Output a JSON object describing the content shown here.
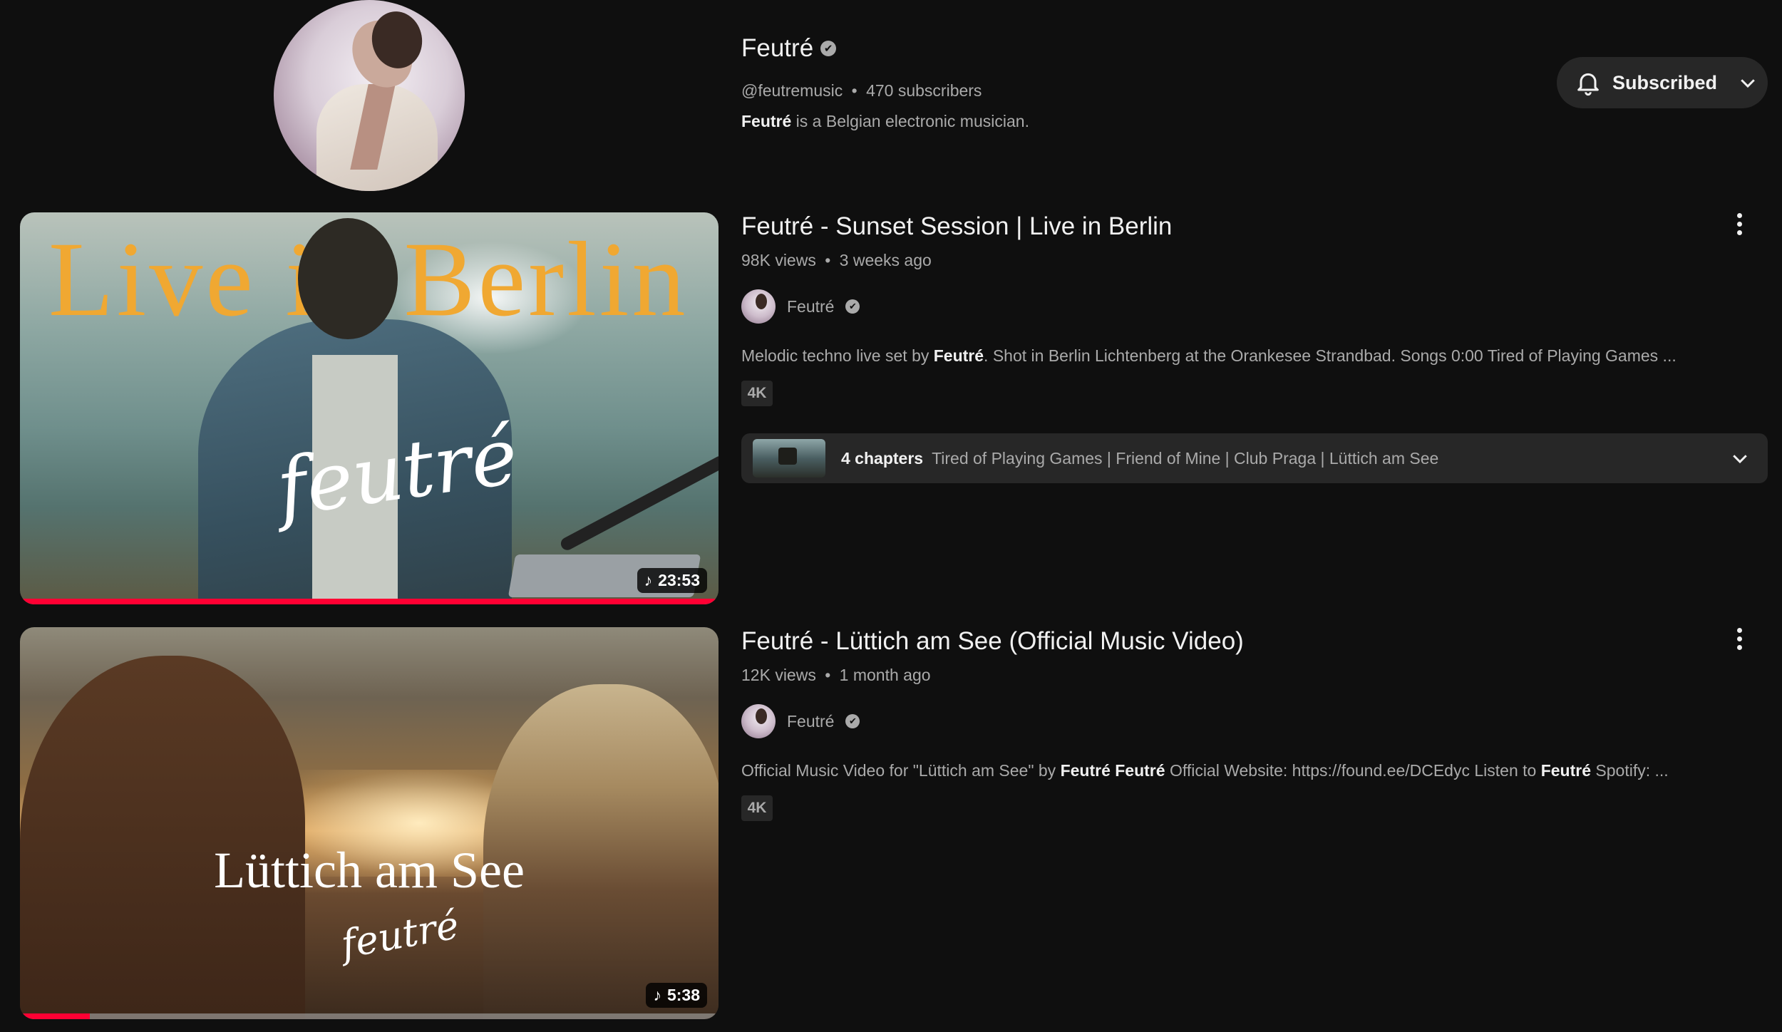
{
  "channel": {
    "name": "Feutré",
    "handle": "@feutremusic",
    "separator": "•",
    "subscribers": "470 subscribers",
    "description_bold": "Feutré",
    "description_rest": " is a Belgian electronic musician.",
    "subscribe_label": "Subscribed",
    "verified_icon": "✔"
  },
  "videos": [
    {
      "title": "Feutré - Sunset Session | Live in Berlin",
      "views": "98K views",
      "separator": "•",
      "age": "3 weeks ago",
      "channel": "Feutré",
      "description": {
        "part1": "Melodic techno live set by ",
        "bold1": "Feutré",
        "part2": ". Shot in Berlin Lichtenberg at the Orankesee Strandbad. Songs 0:00 Tired of Playing Games ..."
      },
      "badge": "4K",
      "duration": "23:53",
      "watched_fraction": 1.0,
      "thumbnail_text": "Live in Berlin",
      "signature_text": "feutré",
      "chapters": {
        "count_label": "4 chapters",
        "list": "Tired of Playing Games | Friend of Mine | Club Praga | Lüttich am See"
      }
    },
    {
      "title": "Feutré - Lüttich am See (Official Music Video)",
      "views": "12K views",
      "separator": "•",
      "age": "1 month ago",
      "channel": "Feutré",
      "description": {
        "part1": "Official Music Video for \"Lüttich am See\" by ",
        "bold1": "Feutré Feutré",
        "part2": " Official Website: https://found.ee/DCEdyc Listen to ",
        "bold2": "Feutré",
        "part3": " Spotify: ..."
      },
      "badge": "4K",
      "duration": "5:38",
      "watched_fraction": 0.1,
      "thumbnail_text": "Lüttich am See",
      "signature_text": "feutré"
    }
  ],
  "colors": {
    "background": "#0f0f0f",
    "primary_text": "#f1f1f1",
    "secondary_text": "#aaaaaa",
    "progress": "#ff0033",
    "chip_bg": "#272727",
    "berlin_title": "#f0a832"
  }
}
